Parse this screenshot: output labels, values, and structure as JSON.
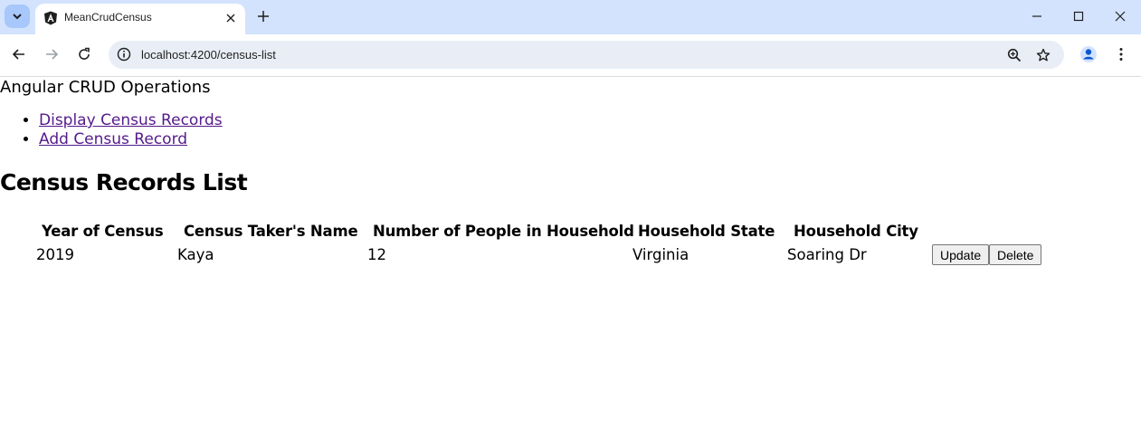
{
  "browser": {
    "tab_title": "MeanCrudCensus",
    "url": "localhost:4200/census-list"
  },
  "page": {
    "app_title": "Angular CRUD Operations",
    "nav_links": [
      "Display Census Records",
      "Add Census Record"
    ],
    "heading": "Census Records List",
    "table": {
      "headers": [
        "Year of Census",
        "Census Taker's Name",
        "Number of People in Household",
        "Household State",
        "Household City"
      ],
      "rows": [
        {
          "year": "2019",
          "taker": "Kaya",
          "people": "12",
          "state": "Virginia",
          "city": "Soaring Dr",
          "update_label": "Update",
          "delete_label": "Delete"
        }
      ]
    }
  },
  "colors": {
    "tabbar_bg": "#d3e3fd",
    "omnibox_bg": "#e9eef6",
    "visited_link": "#551a8b"
  }
}
